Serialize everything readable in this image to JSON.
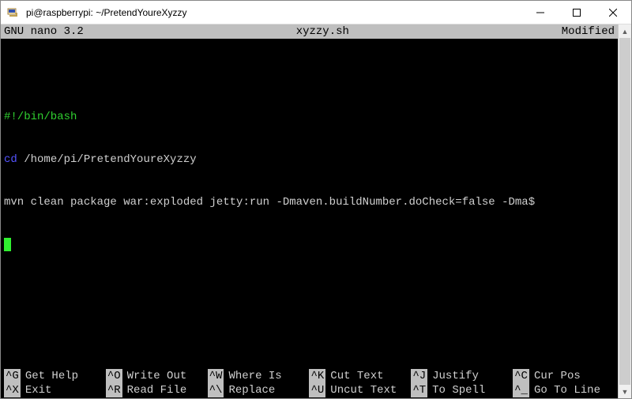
{
  "window": {
    "title": "pi@raspberrypi: ~/PretendYoureXyzzy"
  },
  "nano": {
    "header_left": "  GNU nano 3.2",
    "header_center": "xyzzy.sh",
    "header_right": "Modified  "
  },
  "file": {
    "line1": "#!/bin/bash",
    "line2_cmd": "cd",
    "line2_rest": " /home/pi/PretendYoureXyzzy",
    "line3": "mvn clean package war:exploded jetty:run -Dmaven.buildNumber.doCheck=false -Dma$"
  },
  "shortcuts": {
    "row1": [
      {
        "key": "^G",
        "label": "Get Help"
      },
      {
        "key": "^O",
        "label": "Write Out"
      },
      {
        "key": "^W",
        "label": "Where Is"
      },
      {
        "key": "^K",
        "label": "Cut Text"
      },
      {
        "key": "^J",
        "label": "Justify"
      },
      {
        "key": "^C",
        "label": "Cur Pos"
      }
    ],
    "row2": [
      {
        "key": "^X",
        "label": "Exit"
      },
      {
        "key": "^R",
        "label": "Read File"
      },
      {
        "key": "^\\",
        "label": "Replace"
      },
      {
        "key": "^U",
        "label": "Uncut Text"
      },
      {
        "key": "^T",
        "label": "To Spell"
      },
      {
        "key": "^_",
        "label": "Go To Line"
      }
    ]
  }
}
